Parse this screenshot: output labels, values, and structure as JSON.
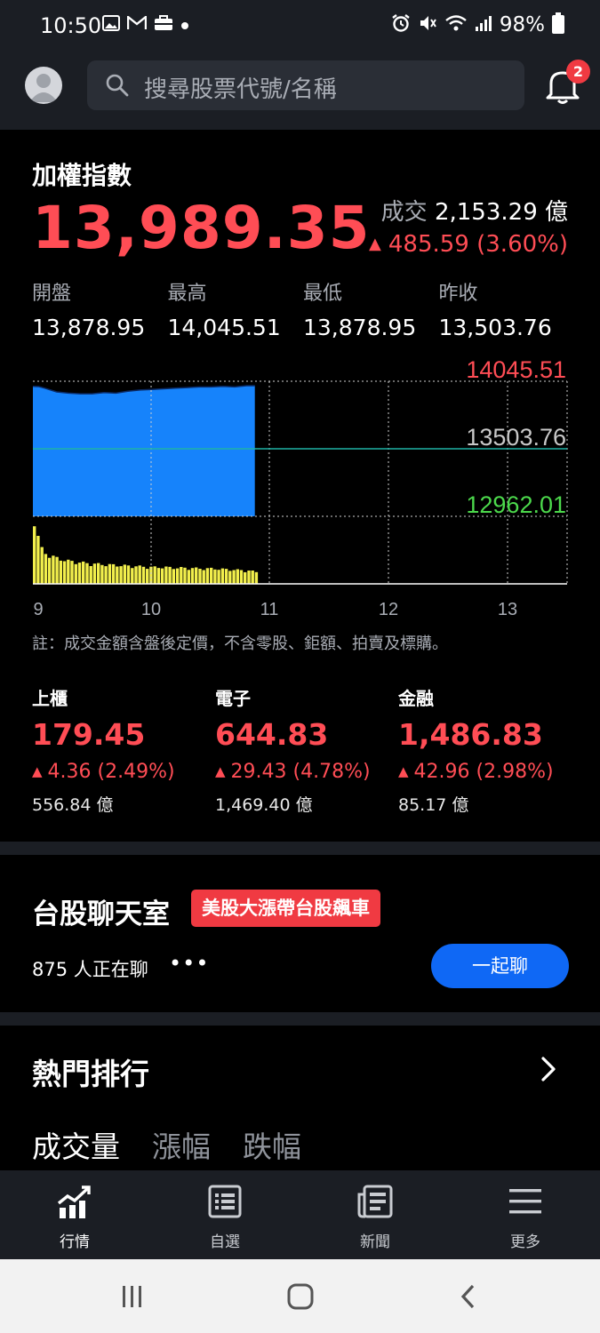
{
  "status_bar": {
    "time": "10:50",
    "battery": "98%"
  },
  "header": {
    "search_placeholder": "搜尋股票代號/名稱",
    "notification_count": "2"
  },
  "index": {
    "title": "加權指數",
    "value": "13,989.35",
    "volume_label": "成交",
    "volume_value": "2,153.29 億",
    "change": "485.59 (3.60%)",
    "stats": [
      {
        "label": "開盤",
        "value": "13,878.95"
      },
      {
        "label": "最高",
        "value": "14,045.51"
      },
      {
        "label": "最低",
        "value": "13,878.95"
      },
      {
        "label": "昨收",
        "value": "13,503.76"
      }
    ]
  },
  "chart_data": {
    "type": "area",
    "y_labels": {
      "high": "14045.51",
      "ref": "13503.76",
      "low": "12962.01"
    },
    "x_ticks": [
      "9",
      "10",
      "11",
      "12",
      "13"
    ],
    "price_series_color": "#1683fb",
    "volume_series_color": "#f2ef4c",
    "ylim": [
      12962.01,
      14045.51
    ],
    "price": {
      "t": [
        9.0,
        9.05,
        9.1,
        9.2,
        9.3,
        9.4,
        9.5,
        9.6,
        9.7,
        9.8,
        9.9,
        10.0,
        10.1,
        10.2,
        10.3,
        10.4,
        10.5,
        10.6,
        10.7,
        10.8,
        10.87
      ],
      "v": [
        14005,
        14003,
        13990,
        13960,
        13950,
        13945,
        13945,
        13955,
        13950,
        13965,
        13975,
        13980,
        13985,
        13990,
        13995,
        14000,
        14000,
        14005,
        14000,
        14010,
        14010
      ]
    },
    "volume": {
      "t": [
        9.0,
        9.05,
        9.1,
        9.2,
        9.3,
        9.4,
        9.5,
        9.6,
        9.7,
        9.8,
        9.9,
        10.0,
        10.1,
        10.2,
        10.3,
        10.4,
        10.5,
        10.6,
        10.7,
        10.8,
        10.87
      ],
      "v": [
        1.0,
        0.55,
        0.45,
        0.38,
        0.34,
        0.32,
        0.3,
        0.29,
        0.28,
        0.27,
        0.26,
        0.25,
        0.25,
        0.24,
        0.24,
        0.23,
        0.23,
        0.22,
        0.21,
        0.2,
        0.18
      ]
    }
  },
  "note": "註：成交金額含盤後定價，不含零股、鉅額、拍賣及標購。",
  "sub_indices": [
    {
      "name": "上櫃",
      "value": "179.45",
      "change": "4.36 (2.49%)",
      "volume": "556.84 億"
    },
    {
      "name": "電子",
      "value": "644.83",
      "change": "29.43 (4.78%)",
      "volume": "1,469.40 億"
    },
    {
      "name": "金融",
      "value": "1,486.83",
      "change": "42.96 (2.98%)",
      "volume": "85.17 億"
    }
  ],
  "chat": {
    "title": "台股聊天室",
    "tag": "美股大漲帶台股飆車",
    "count": "875 人正在聊",
    "button": "一起聊"
  },
  "hot": {
    "title": "熱門排行",
    "tabs": [
      "成交量",
      "漲幅",
      "跌幅"
    ]
  },
  "bottom_nav": [
    {
      "label": "行情",
      "icon": "chart-icon"
    },
    {
      "label": "自選",
      "icon": "watchlist-icon"
    },
    {
      "label": "新聞",
      "icon": "news-icon"
    },
    {
      "label": "更多",
      "icon": "menu-icon"
    }
  ],
  "colors": {
    "up": "#ff4d55",
    "low_label": "#4cd94c",
    "accent": "#0f68f5"
  }
}
